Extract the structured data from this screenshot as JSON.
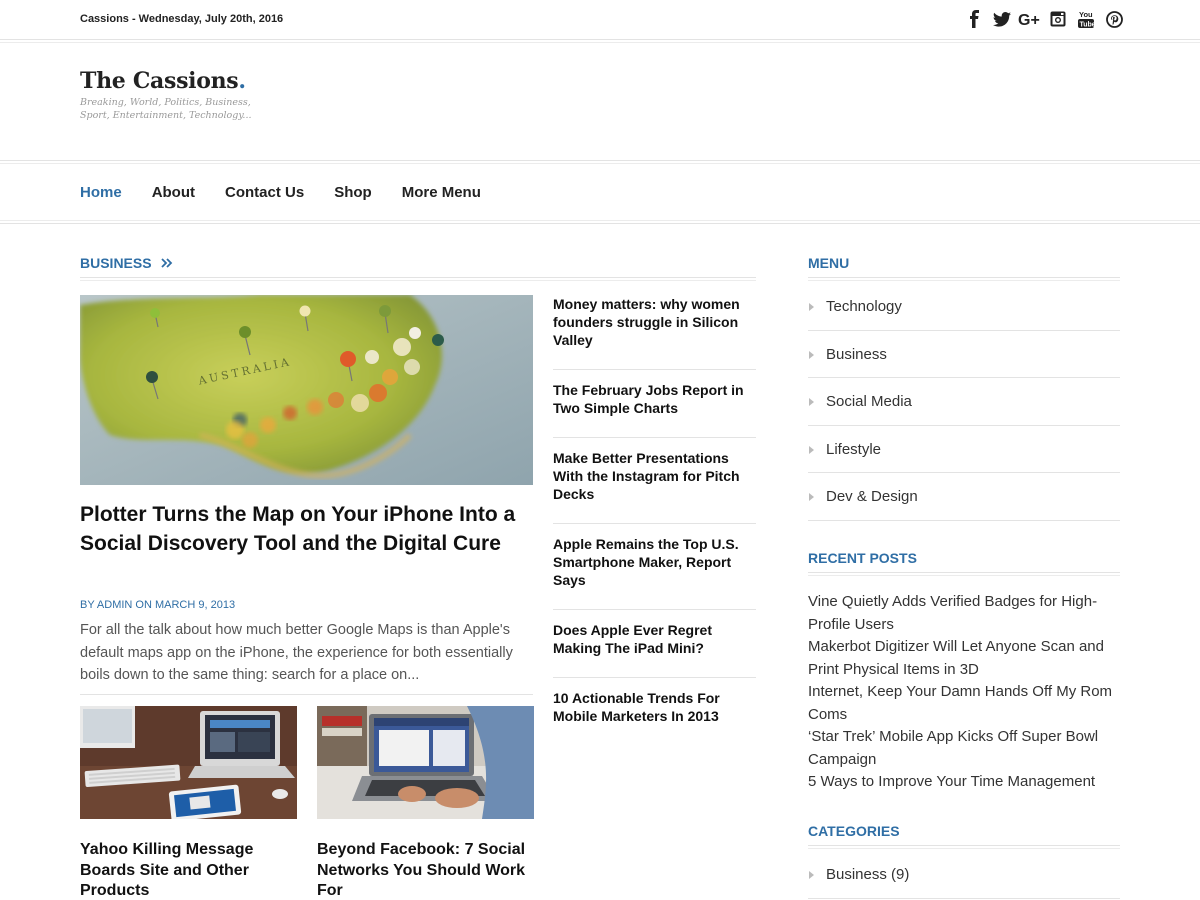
{
  "topbar": {
    "date": "Cassions - Wednesday, July 20th, 2016",
    "social_icons": [
      "facebook-icon",
      "twitter-icon",
      "google-plus-icon",
      "instagram-icon",
      "youtube-icon",
      "pinterest-icon"
    ]
  },
  "header": {
    "title": "The Cassions",
    "title_dot": ".",
    "tagline": "Breaking, World, Politics, Business, Sport, Entertainment, Technology..."
  },
  "nav": {
    "items": [
      {
        "label": "Home"
      },
      {
        "label": "About"
      },
      {
        "label": "Contact Us"
      },
      {
        "label": "Shop"
      },
      {
        "label": "More Menu"
      }
    ]
  },
  "business": {
    "heading": "BUSINESS",
    "heading_icon": "double-chevron-right-icon",
    "featured": {
      "title": "Plotter Turns the Map on Your iPhone Into a Social Discovery Tool and the Digital Cure",
      "meta": "BY ADMIN ON MARCH 9, 2013",
      "excerpt": "For all the talk about how much better Google Maps is than Apple's default maps app on the iPhone, the experience for both essentially boils down to the same thing: search for a place on...",
      "image_label": "AUSTRALIA"
    },
    "cards": [
      {
        "title": "Yahoo Killing Message Boards Site and Other Products"
      },
      {
        "title": "Beyond Facebook: 7 Social Networks You Should Work For"
      }
    ],
    "side_list": [
      {
        "title": "Money matters: why women founders struggle in Silicon Valley"
      },
      {
        "title": "The February Jobs Report in Two Simple Charts"
      },
      {
        "title": "Make Better Presentations With the Instagram for Pitch Decks"
      },
      {
        "title": "Apple Remains the Top U.S. Smartphone Maker, Report Says"
      },
      {
        "title": "Does Apple Ever Regret Making The iPad Mini?"
      },
      {
        "title": "10 Actionable Trends For Mobile Marketers In 2013"
      }
    ]
  },
  "sidebar": {
    "menu_heading": "MENU",
    "menu_items": [
      {
        "label": "Technology"
      },
      {
        "label": "Business"
      },
      {
        "label": "Social Media"
      },
      {
        "label": "Lifestyle"
      },
      {
        "label": "Dev & Design"
      }
    ],
    "recent_heading": "RECENT POSTS",
    "recent_posts": [
      {
        "title": "Vine Quietly Adds Verified Badges for High-Profile Users"
      },
      {
        "title": "Makerbot Digitizer Will Let Anyone Scan and Print Physical Items in 3D"
      },
      {
        "title": "Internet, Keep Your Damn Hands Off My Rom Coms"
      },
      {
        "title": "‘Star Trek’ Mobile App Kicks Off Super Bowl Campaign"
      },
      {
        "title": "5 Ways to Improve Your Time Management"
      }
    ],
    "categories_heading": "CATEGORIES",
    "categories": [
      {
        "label": "Business (9)"
      }
    ]
  },
  "colors": {
    "accent": "#2f6ea5",
    "text": "#222222",
    "muted": "#555555",
    "border": "#e3e3e3"
  }
}
